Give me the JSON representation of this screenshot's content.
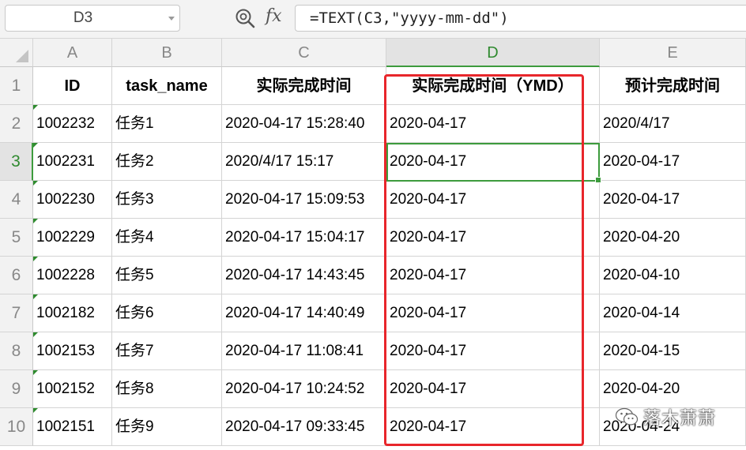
{
  "formula_bar": {
    "name_box": "D3",
    "fx_label": "fx",
    "formula": "=TEXT(C3,\"yyyy-mm-dd\")"
  },
  "columns": [
    "A",
    "B",
    "C",
    "D",
    "E"
  ],
  "selected_column": "D",
  "rows": [
    {
      "num": "1",
      "cells": [
        "ID",
        "task_name",
        "实际完成时间",
        "实际完成时间（YMD）",
        "预计完成时间"
      ]
    },
    {
      "num": "2",
      "cells": [
        "1002232",
        "任务1",
        "2020-04-17 15:28:40",
        "2020-04-17",
        "2020/4/17"
      ]
    },
    {
      "num": "3",
      "cells": [
        "1002231",
        "任务2",
        "2020/4/17 15:17",
        "2020-04-17",
        "2020-04-17"
      ]
    },
    {
      "num": "4",
      "cells": [
        "1002230",
        "任务3",
        "2020-04-17 15:09:53",
        "2020-04-17",
        "2020-04-17"
      ]
    },
    {
      "num": "5",
      "cells": [
        "1002229",
        "任务4",
        "2020-04-17 15:04:17",
        "2020-04-17",
        "2020-04-20"
      ]
    },
    {
      "num": "6",
      "cells": [
        "1002228",
        "任务5",
        "2020-04-17 14:43:45",
        "2020-04-17",
        "2020-04-10"
      ]
    },
    {
      "num": "7",
      "cells": [
        "1002182",
        "任务6",
        "2020-04-17 14:40:49",
        "2020-04-17",
        "2020-04-14"
      ]
    },
    {
      "num": "8",
      "cells": [
        "1002153",
        "任务7",
        "2020-04-17 11:08:41",
        "2020-04-17",
        "2020-04-15"
      ]
    },
    {
      "num": "9",
      "cells": [
        "1002152",
        "任务8",
        "2020-04-17 10:24:52",
        "2020-04-17",
        "2020-04-20"
      ]
    },
    {
      "num": "10",
      "cells": [
        "1002151",
        "任务9",
        "2020-04-17 09:33:45",
        "2020-04-17",
        "2020-04-24"
      ]
    }
  ],
  "selected_row": "3",
  "watermark": "落木萧萧",
  "colors": {
    "selection": "#3d9b3d",
    "highlight": "#e8262b"
  }
}
